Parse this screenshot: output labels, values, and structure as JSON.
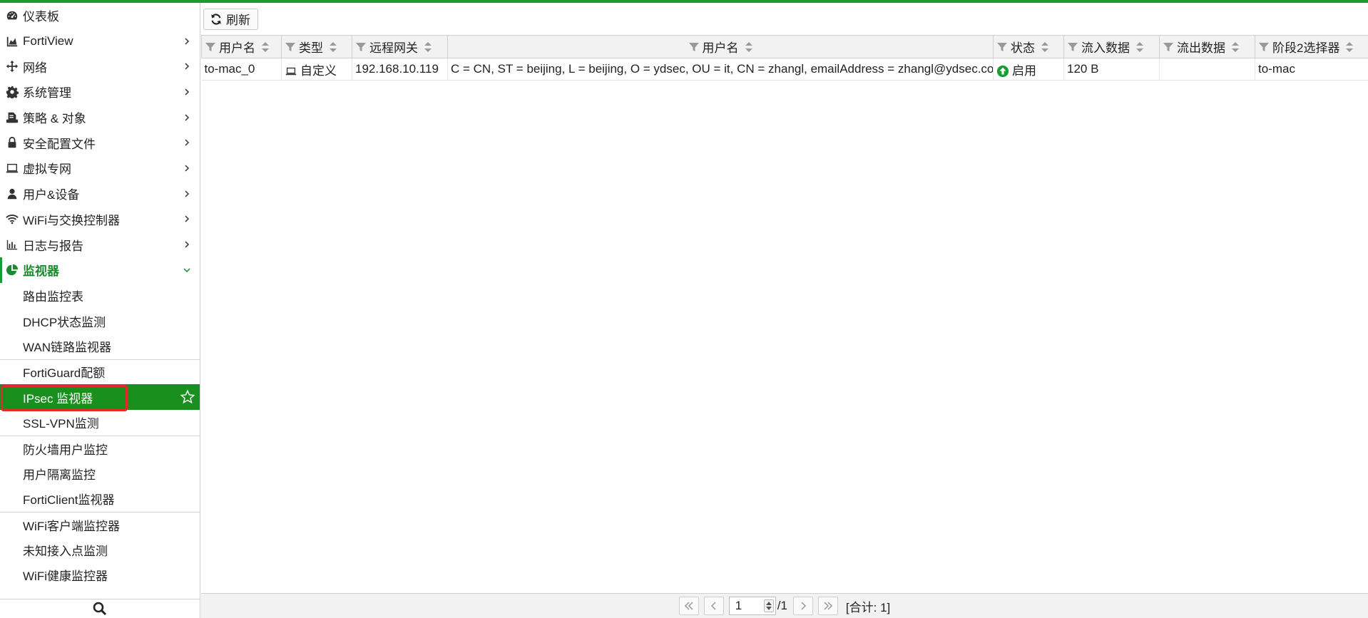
{
  "sidebar": {
    "items": [
      {
        "label": "仪表板",
        "icon": "dashboard-icon",
        "chevron": false
      },
      {
        "label": "FortiView",
        "icon": "chart-area-icon",
        "chevron": true
      },
      {
        "label": "网络",
        "icon": "network-arrows-icon",
        "chevron": true
      },
      {
        "label": "系统管理",
        "icon": "gear-icon",
        "chevron": true
      },
      {
        "label": "策略 & 对象",
        "icon": "policy-icon",
        "chevron": true
      },
      {
        "label": "安全配置文件",
        "icon": "lock-icon",
        "chevron": true
      },
      {
        "label": "虚拟专网",
        "icon": "laptop-icon",
        "chevron": true
      },
      {
        "label": "用户&设备",
        "icon": "user-icon",
        "chevron": true
      },
      {
        "label": "WiFi与交换控制器",
        "icon": "wifi-icon",
        "chevron": true
      },
      {
        "label": "日志与报告",
        "icon": "bar-chart-icon",
        "chevron": true
      }
    ],
    "active_parent": {
      "label": "监视器",
      "icon": "pie-chart-icon"
    },
    "sub_items": [
      {
        "label": "路由监控表"
      },
      {
        "label": "DHCP状态监测"
      },
      {
        "label": "WAN链路监视器"
      },
      {
        "label": "FortiGuard配额"
      },
      {
        "label": "IPsec 监视器"
      },
      {
        "label": "SSL-VPN监测"
      },
      {
        "label": "防火墙用户监控"
      },
      {
        "label": "用户隔离监控"
      },
      {
        "label": "FortiClient监视器"
      },
      {
        "label": "WiFi客户端监控器"
      },
      {
        "label": "未知接入点监测"
      },
      {
        "label": "WiFi健康监控器"
      }
    ],
    "search_icon": "search-icon"
  },
  "toolbar": {
    "refresh_label": "刷新"
  },
  "table": {
    "columns": [
      "用户名",
      "类型",
      "远程网关",
      "用户名",
      "状态",
      "流入数据",
      "流出数据",
      "阶段2选择器"
    ],
    "rows": [
      {
        "name": "to-mac_0",
        "type": "自定义",
        "gateway": "192.168.10.119",
        "user": "C = CN, ST = beijing, L = beijing, O = ydsec, OU = it, CN = zhangl, emailAddress = zhangl@ydsec.com",
        "status": "启用",
        "in": "120 B",
        "out": "",
        "phase2": "to-mac"
      }
    ]
  },
  "pager": {
    "page": "1",
    "total_pages": "/1",
    "total_label": "[合计: 1]"
  },
  "colors": {
    "brand_green": "#1c9a34",
    "selected_bg": "#19901d",
    "highlight_red": "#e52828"
  }
}
